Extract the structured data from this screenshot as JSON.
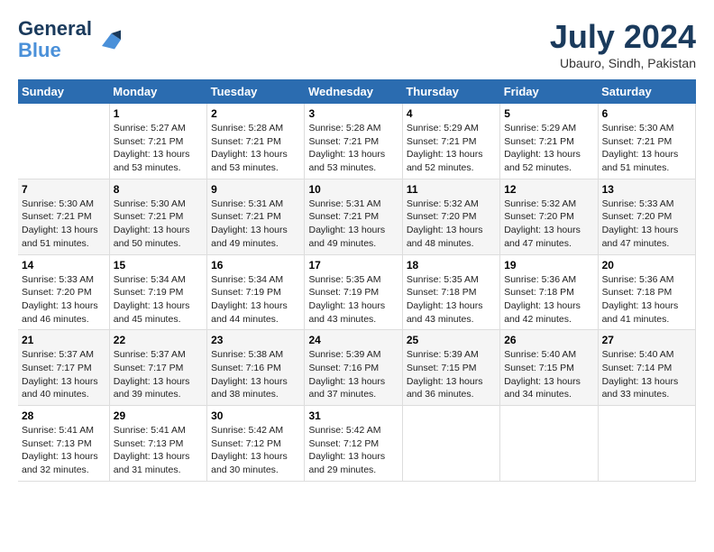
{
  "header": {
    "logo_line1": "General",
    "logo_line2": "Blue",
    "month_year": "July 2024",
    "location": "Ubauro, Sindh, Pakistan"
  },
  "days_of_week": [
    "Sunday",
    "Monday",
    "Tuesday",
    "Wednesday",
    "Thursday",
    "Friday",
    "Saturday"
  ],
  "weeks": [
    [
      {
        "day": "",
        "info": ""
      },
      {
        "day": "1",
        "info": "Sunrise: 5:27 AM\nSunset: 7:21 PM\nDaylight: 13 hours\nand 53 minutes."
      },
      {
        "day": "2",
        "info": "Sunrise: 5:28 AM\nSunset: 7:21 PM\nDaylight: 13 hours\nand 53 minutes."
      },
      {
        "day": "3",
        "info": "Sunrise: 5:28 AM\nSunset: 7:21 PM\nDaylight: 13 hours\nand 53 minutes."
      },
      {
        "day": "4",
        "info": "Sunrise: 5:29 AM\nSunset: 7:21 PM\nDaylight: 13 hours\nand 52 minutes."
      },
      {
        "day": "5",
        "info": "Sunrise: 5:29 AM\nSunset: 7:21 PM\nDaylight: 13 hours\nand 52 minutes."
      },
      {
        "day": "6",
        "info": "Sunrise: 5:30 AM\nSunset: 7:21 PM\nDaylight: 13 hours\nand 51 minutes."
      }
    ],
    [
      {
        "day": "7",
        "info": "Sunrise: 5:30 AM\nSunset: 7:21 PM\nDaylight: 13 hours\nand 51 minutes."
      },
      {
        "day": "8",
        "info": "Sunrise: 5:30 AM\nSunset: 7:21 PM\nDaylight: 13 hours\nand 50 minutes."
      },
      {
        "day": "9",
        "info": "Sunrise: 5:31 AM\nSunset: 7:21 PM\nDaylight: 13 hours\nand 49 minutes."
      },
      {
        "day": "10",
        "info": "Sunrise: 5:31 AM\nSunset: 7:21 PM\nDaylight: 13 hours\nand 49 minutes."
      },
      {
        "day": "11",
        "info": "Sunrise: 5:32 AM\nSunset: 7:20 PM\nDaylight: 13 hours\nand 48 minutes."
      },
      {
        "day": "12",
        "info": "Sunrise: 5:32 AM\nSunset: 7:20 PM\nDaylight: 13 hours\nand 47 minutes."
      },
      {
        "day": "13",
        "info": "Sunrise: 5:33 AM\nSunset: 7:20 PM\nDaylight: 13 hours\nand 47 minutes."
      }
    ],
    [
      {
        "day": "14",
        "info": "Sunrise: 5:33 AM\nSunset: 7:20 PM\nDaylight: 13 hours\nand 46 minutes."
      },
      {
        "day": "15",
        "info": "Sunrise: 5:34 AM\nSunset: 7:19 PM\nDaylight: 13 hours\nand 45 minutes."
      },
      {
        "day": "16",
        "info": "Sunrise: 5:34 AM\nSunset: 7:19 PM\nDaylight: 13 hours\nand 44 minutes."
      },
      {
        "day": "17",
        "info": "Sunrise: 5:35 AM\nSunset: 7:19 PM\nDaylight: 13 hours\nand 43 minutes."
      },
      {
        "day": "18",
        "info": "Sunrise: 5:35 AM\nSunset: 7:18 PM\nDaylight: 13 hours\nand 43 minutes."
      },
      {
        "day": "19",
        "info": "Sunrise: 5:36 AM\nSunset: 7:18 PM\nDaylight: 13 hours\nand 42 minutes."
      },
      {
        "day": "20",
        "info": "Sunrise: 5:36 AM\nSunset: 7:18 PM\nDaylight: 13 hours\nand 41 minutes."
      }
    ],
    [
      {
        "day": "21",
        "info": "Sunrise: 5:37 AM\nSunset: 7:17 PM\nDaylight: 13 hours\nand 40 minutes."
      },
      {
        "day": "22",
        "info": "Sunrise: 5:37 AM\nSunset: 7:17 PM\nDaylight: 13 hours\nand 39 minutes."
      },
      {
        "day": "23",
        "info": "Sunrise: 5:38 AM\nSunset: 7:16 PM\nDaylight: 13 hours\nand 38 minutes."
      },
      {
        "day": "24",
        "info": "Sunrise: 5:39 AM\nSunset: 7:16 PM\nDaylight: 13 hours\nand 37 minutes."
      },
      {
        "day": "25",
        "info": "Sunrise: 5:39 AM\nSunset: 7:15 PM\nDaylight: 13 hours\nand 36 minutes."
      },
      {
        "day": "26",
        "info": "Sunrise: 5:40 AM\nSunset: 7:15 PM\nDaylight: 13 hours\nand 34 minutes."
      },
      {
        "day": "27",
        "info": "Sunrise: 5:40 AM\nSunset: 7:14 PM\nDaylight: 13 hours\nand 33 minutes."
      }
    ],
    [
      {
        "day": "28",
        "info": "Sunrise: 5:41 AM\nSunset: 7:13 PM\nDaylight: 13 hours\nand 32 minutes."
      },
      {
        "day": "29",
        "info": "Sunrise: 5:41 AM\nSunset: 7:13 PM\nDaylight: 13 hours\nand 31 minutes."
      },
      {
        "day": "30",
        "info": "Sunrise: 5:42 AM\nSunset: 7:12 PM\nDaylight: 13 hours\nand 30 minutes."
      },
      {
        "day": "31",
        "info": "Sunrise: 5:42 AM\nSunset: 7:12 PM\nDaylight: 13 hours\nand 29 minutes."
      },
      {
        "day": "",
        "info": ""
      },
      {
        "day": "",
        "info": ""
      },
      {
        "day": "",
        "info": ""
      }
    ]
  ]
}
